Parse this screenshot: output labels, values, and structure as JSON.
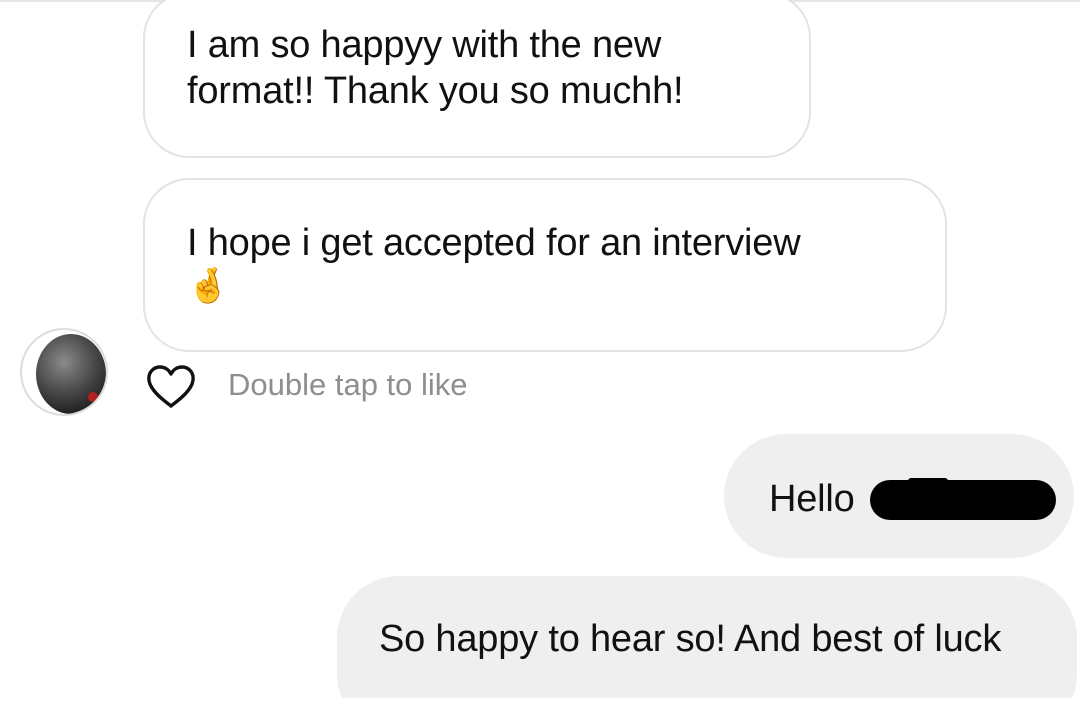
{
  "messages": [
    {
      "text": "I am so happyy with the new format!! Thank you so muchh!"
    },
    {
      "text": "I hope i get accepted for an interview",
      "emoji": "🤞"
    },
    {
      "text": "Hello"
    },
    {
      "text": "So happy to hear so! And best of luck"
    }
  ],
  "like_hint": "Double tap to like",
  "icons": {
    "heart": "heart-icon",
    "avatar": "avatar"
  },
  "colors": {
    "outgoing_bubble": "#efefef",
    "incoming_border": "#e3e3e3",
    "muted_text": "#8e8e8e"
  }
}
